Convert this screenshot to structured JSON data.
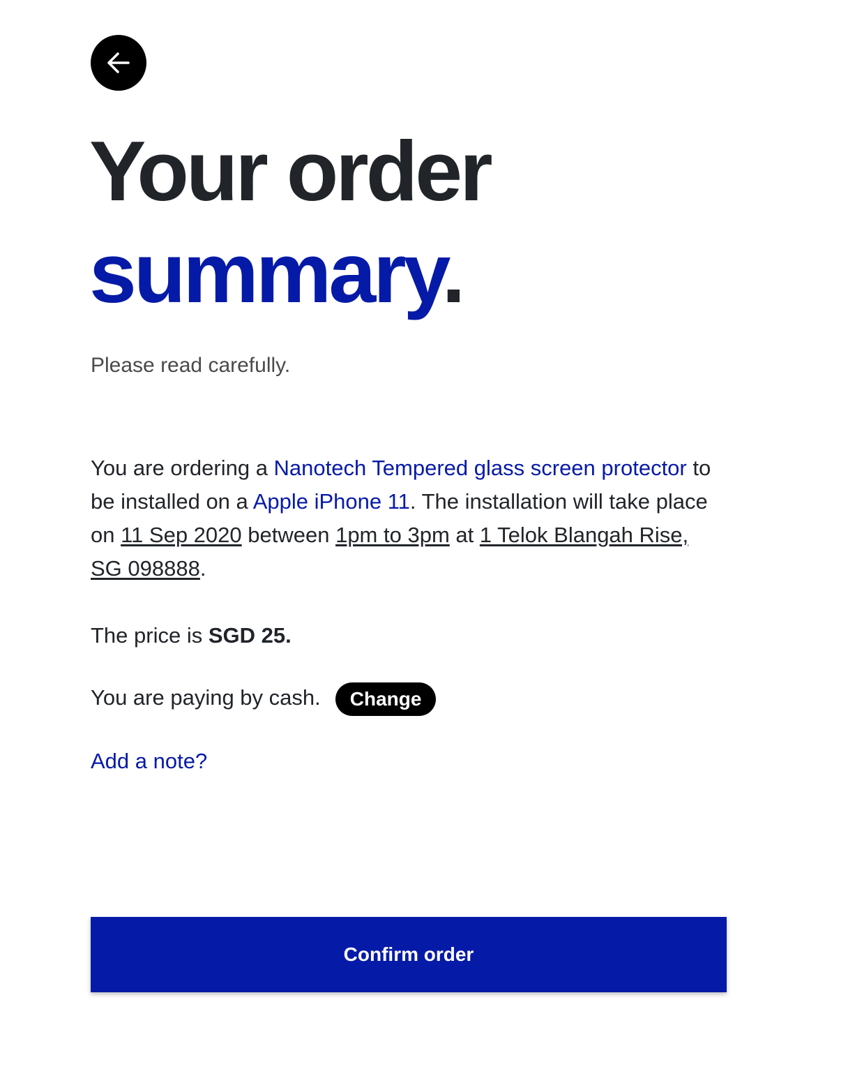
{
  "header": {
    "back_icon": "arrow-left-icon",
    "title_line1": "Your order",
    "title_line2": "summary",
    "title_period": ".",
    "subtitle": "Please read carefully."
  },
  "summary": {
    "intro": "You are ordering a ",
    "product": "Nanotech Tempered glass screen protector",
    "mid1": " to be installed on a ",
    "device": "Apple iPhone 11",
    "mid2": ". The installation will take place on ",
    "date": "11 Sep 2020",
    "mid3": " between ",
    "time": "1pm to 3pm",
    "mid4": " at ",
    "address": "1 Telok Blangah Rise, SG 098888",
    "end": "."
  },
  "price": {
    "label": "The price is ",
    "value": "SGD 25."
  },
  "payment": {
    "text": "You are paying by cash.",
    "change_label": "Change"
  },
  "note": {
    "label": "Add a note?"
  },
  "actions": {
    "confirm_label": "Confirm order"
  },
  "colors": {
    "accent": "#061aa8",
    "text": "#212529",
    "button_dark": "#000000"
  }
}
